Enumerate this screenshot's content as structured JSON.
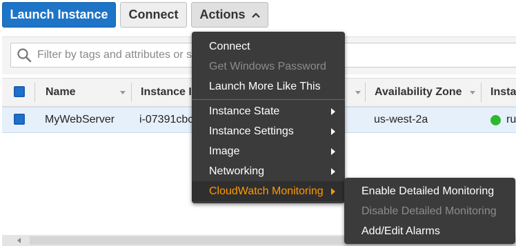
{
  "toolbar": {
    "launch_label": "Launch Instance",
    "connect_label": "Connect",
    "actions_label": "Actions"
  },
  "search": {
    "placeholder": "Filter by tags and attributes or s"
  },
  "table": {
    "columns": [
      "Name",
      "Instance I",
      "Availability Zone",
      "Insta"
    ],
    "rows": [
      {
        "name": "MyWebServer",
        "instance_id": "i-07391cbc",
        "availability_zone": "us-west-2a",
        "state": "ru"
      }
    ]
  },
  "actions_menu": {
    "items": [
      {
        "label": "Connect",
        "disabled": false
      },
      {
        "label": "Get Windows Password",
        "disabled": true
      },
      {
        "label": "Launch More Like This",
        "disabled": false
      },
      {
        "label": "Instance State",
        "submenu": true
      },
      {
        "label": "Instance Settings",
        "submenu": true
      },
      {
        "label": "Image",
        "submenu": true
      },
      {
        "label": "Networking",
        "submenu": true
      },
      {
        "label": "CloudWatch Monitoring",
        "submenu": true,
        "active": true
      }
    ]
  },
  "cloudwatch_submenu": {
    "items": [
      {
        "label": "Enable Detailed Monitoring",
        "disabled": false
      },
      {
        "label": "Disable Detailed Monitoring",
        "disabled": true
      },
      {
        "label": "Add/Edit Alarms",
        "disabled": false
      }
    ]
  },
  "colors": {
    "primary": "#1e74c6",
    "menu_bg": "#3b3b3b",
    "highlight": "#ff9900",
    "running": "#2eb82e",
    "row_selected": "#e6f0fb"
  },
  "icons": [
    "search-icon",
    "caret-up-icon",
    "chevron-right-icon",
    "sort-down-icon",
    "status-running-icon"
  ]
}
